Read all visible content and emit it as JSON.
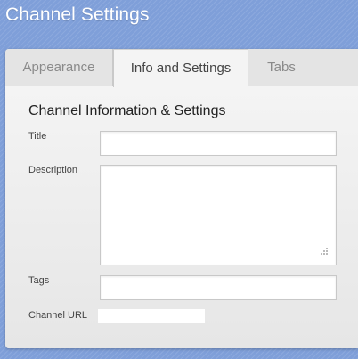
{
  "header": {
    "title": "Channel Settings"
  },
  "tabs": [
    {
      "label": "Appearance"
    },
    {
      "label": "Info and Settings"
    },
    {
      "label": "Tabs"
    }
  ],
  "section": {
    "heading": "Channel Information & Settings"
  },
  "form": {
    "title_label": "Title",
    "title_value": "",
    "description_label": "Description",
    "description_value": "",
    "tags_label": "Tags",
    "tags_value": "",
    "url_label": "Channel URL",
    "url_value": ""
  },
  "colors": {
    "background": "#7f9fd9",
    "panel": "#e9e9e9",
    "active_tab": "#f4f4f4"
  }
}
